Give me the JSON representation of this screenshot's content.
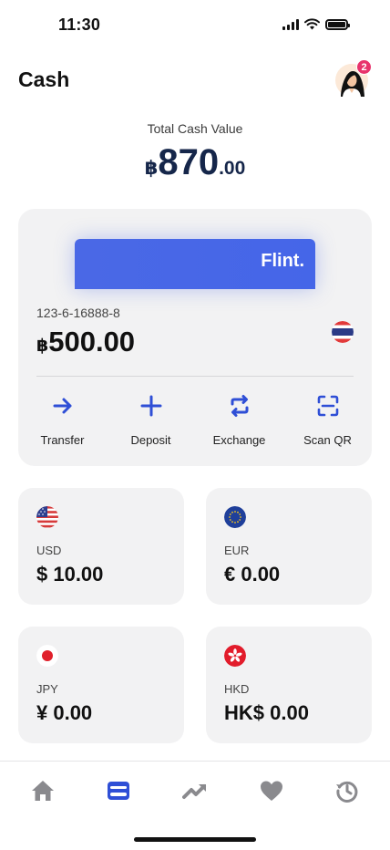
{
  "status_bar": {
    "time": "11:30"
  },
  "header": {
    "title": "Cash",
    "notification_count": "2"
  },
  "total": {
    "label": "Total Cash Value",
    "currency_symbol": "฿",
    "amount_int": "870",
    "amount_dec": ".00"
  },
  "main_account": {
    "card_brand": "Flint.",
    "account_number": "123-6-16888-8",
    "currency_symbol": "฿",
    "balance": "500.00",
    "flag_icon": "thailand-flag-icon"
  },
  "actions": [
    {
      "label": "Transfer",
      "icon": "arrow-right-icon"
    },
    {
      "label": "Deposit",
      "icon": "plus-icon"
    },
    {
      "label": "Exchange",
      "icon": "exchange-icon"
    },
    {
      "label": "Scan QR",
      "icon": "scan-qr-icon"
    }
  ],
  "wallets": [
    {
      "code": "USD",
      "amount": "$ 10.00",
      "flag_icon": "usa-flag-icon"
    },
    {
      "code": "EUR",
      "amount": "€ 0.00",
      "flag_icon": "eu-flag-icon"
    },
    {
      "code": "JPY",
      "amount": "¥ 0.00",
      "flag_icon": "japan-flag-icon"
    },
    {
      "code": "HKD",
      "amount": "HK$ 0.00",
      "flag_icon": "hong-kong-flag-icon"
    }
  ],
  "bottom_nav": [
    {
      "icon": "home-icon",
      "active": false
    },
    {
      "icon": "wallet-icon",
      "active": true
    },
    {
      "icon": "trend-icon",
      "active": false
    },
    {
      "icon": "heart-icon",
      "active": false
    },
    {
      "icon": "history-icon",
      "active": false
    }
  ],
  "colors": {
    "accent": "#2f4fd6",
    "card_blue": "#4a68e6",
    "total_amount": "#15264a",
    "tile_background": "#f2f2f3",
    "badge": "#e8336c",
    "inactive_nav": "#8a8a8e"
  }
}
